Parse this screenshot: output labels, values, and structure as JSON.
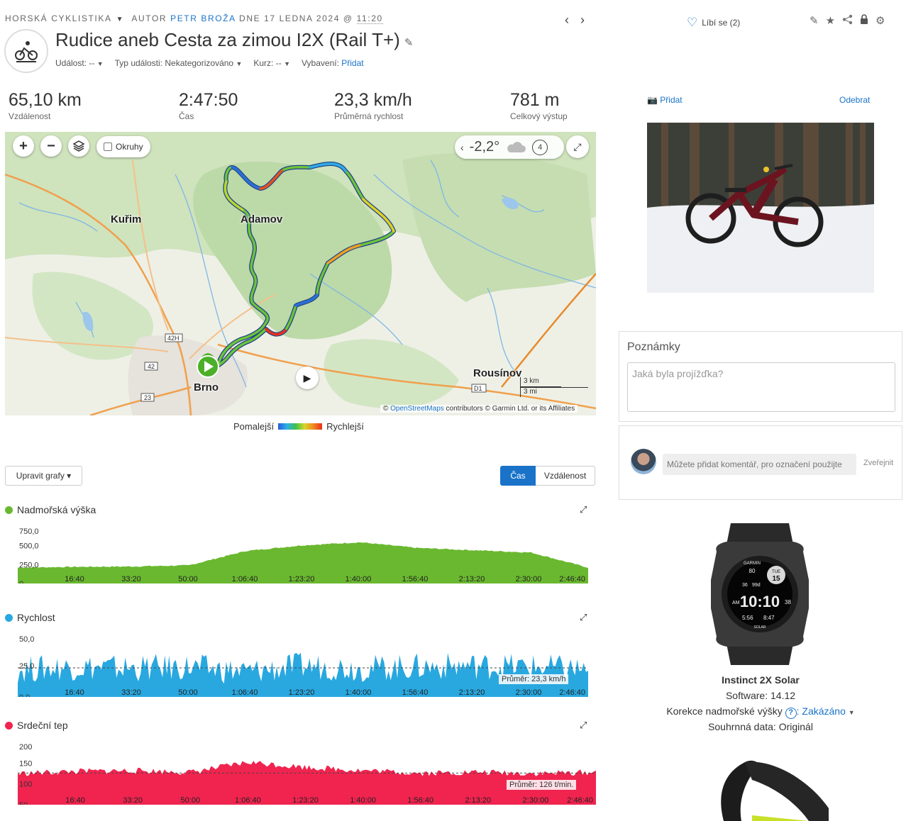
{
  "breadcrumb": {
    "category": "HORSKÁ CYKLISTIKA",
    "author_prefix": "AUTOR",
    "author": "PETR BROŽA",
    "date_text": "DNE 17 LEDNA 2024 @",
    "time": "11:20"
  },
  "activity": {
    "title": "Rudice aneb Cesta za zimou I2X (Rail T+)",
    "event_label": "Událost:",
    "event_value": "--",
    "event_type_label": "Typ události:",
    "event_type_value": "Nekategorizováno",
    "course_label": "Kurz:",
    "course_value": "--",
    "gear_label": "Vybavení:",
    "gear_value": "Přidat"
  },
  "likes": {
    "label": "Líbí se (2)"
  },
  "stats": [
    {
      "value": "65,10 km",
      "label": "Vzdálenost"
    },
    {
      "value": "2:47:50",
      "label": "Čas"
    },
    {
      "value": "23,3 km/h",
      "label": "Průměrná rychlost"
    },
    {
      "value": "781 m",
      "label": "Celkový výstup"
    }
  ],
  "map": {
    "okruhy": "Okruhy",
    "temperature": "-2,2°",
    "wind": "4",
    "cities": {
      "kurim": "Kuřim",
      "adamov": "Adamov",
      "brno": "Brno",
      "rousinov": "Rousínov"
    },
    "roads": {
      "r42h": "42H",
      "r42": "42",
      "r23": "23",
      "d1": "D1"
    },
    "scale_km": "3 km",
    "scale_mi": "3 mi",
    "attribution_prefix": "©",
    "attribution_link": "OpenStreetMaps",
    "attribution_rest": "contributors © Garmin Ltd. or its Affiliates",
    "legend_slow": "Pomalejší",
    "legend_fast": "Rychlejší"
  },
  "graph_controls": {
    "edit_label": "Upravit grafy ▾",
    "time_label": "Čas",
    "distance_label": "Vzdálenost"
  },
  "x_ticks": [
    "16:40",
    "33:20",
    "50:00",
    "1:06:40",
    "1:23:20",
    "1:40:00",
    "1:56:40",
    "2:13:20",
    "2:30:00",
    "2:46:40"
  ],
  "charts": {
    "elevation": {
      "title": "Nadmořská výška",
      "color": "#6ab830",
      "y_ticks": [
        "750,0",
        "500,0",
        "250,0",
        "0"
      ]
    },
    "speed": {
      "title": "Rychlost",
      "color": "#29a8e0",
      "y_ticks": [
        "50,0",
        "25,0",
        "0,0"
      ],
      "avg_label": "Průměr: 23,3 km/h"
    },
    "heart": {
      "title": "Srdeční tep",
      "color": "#f0244f",
      "y_ticks": [
        "200",
        "150",
        "100",
        "50"
      ],
      "avg_label": "Průměr: 126 t/min."
    }
  },
  "chart_data": [
    {
      "type": "area",
      "title": "Nadmořská výška",
      "xlabel": "",
      "ylabel": "",
      "ylim": [
        0,
        750
      ],
      "x": [
        "0:00",
        "16:40",
        "33:20",
        "50:00",
        "1:06:40",
        "1:23:20",
        "1:40:00",
        "1:56:40",
        "2:13:20",
        "2:30:00",
        "2:46:40"
      ],
      "series": [
        {
          "values": [
            210,
            220,
            225,
            240,
            430,
            505,
            545,
            470,
            440,
            410,
            210
          ]
        }
      ]
    },
    {
      "type": "area",
      "title": "Rychlost",
      "ylim": [
        0,
        50
      ],
      "average": 23.3,
      "x": [
        "0:00",
        "16:40",
        "33:20",
        "50:00",
        "1:06:40",
        "1:23:20",
        "1:40:00",
        "1:56:40",
        "2:13:20",
        "2:30:00",
        "2:46:40"
      ],
      "series": [
        {
          "values": [
            22,
            24,
            23,
            24,
            20,
            25,
            23,
            24,
            25,
            24,
            22
          ]
        }
      ]
    },
    {
      "type": "area",
      "title": "Srdeční tep",
      "ylim": [
        50,
        200
      ],
      "average": 126,
      "x": [
        "0:00",
        "16:40",
        "33:20",
        "50:00",
        "1:06:40",
        "1:23:20",
        "1:40:00",
        "1:56:40",
        "2:13:20",
        "2:30:00",
        "2:46:40"
      ],
      "series": [
        {
          "values": [
            125,
            130,
            132,
            128,
            152,
            140,
            132,
            126,
            128,
            125,
            128
          ]
        }
      ]
    }
  ],
  "photos": {
    "add_label": "Přidat",
    "remove_label": "Odebrat"
  },
  "notes": {
    "title": "Poznámky",
    "placeholder": "Jaká byla projížďka?"
  },
  "comment": {
    "placeholder": "Můžete přidat komentář, pro označení použijte",
    "publish": "Zveřejnit"
  },
  "device": {
    "name": "Instinct 2X Solar",
    "software": "Software: 14.12",
    "elev_corr_label": "Korekce nadmořské výšky",
    "elev_corr_value": "Zakázáno",
    "summary": "Souhrnná data: Originál",
    "watch_face": {
      "brand": "GARMIN",
      "time": "10:10",
      "sec": "38",
      "am": "AM",
      "day": "TUE",
      "date": "15",
      "top_left": "80",
      "mid": "36",
      "mid2": "99d",
      "b1": "5:56",
      "b2": "8:47",
      "solar": "SOLAR"
    }
  }
}
